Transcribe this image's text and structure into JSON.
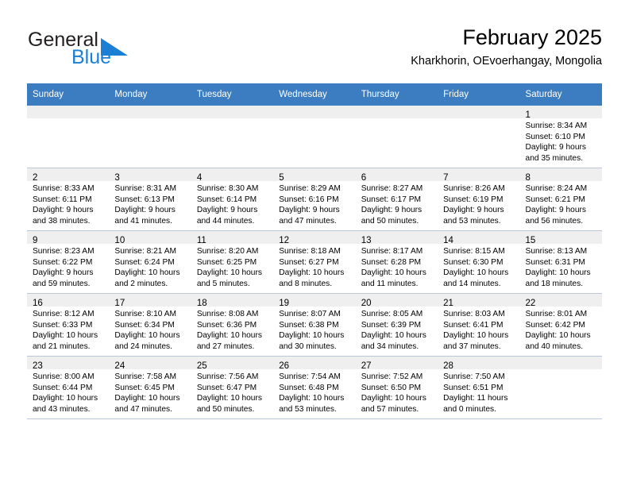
{
  "brand": {
    "name_part1": "General",
    "name_part2": "Blue",
    "triangle_color": "#1b7fd4",
    "text_color": "#231f20"
  },
  "header": {
    "title": "February 2025",
    "subtitle": "Kharkhorin, OEvoerhangay, Mongolia"
  },
  "theme": {
    "header_bg": "#3b7dc0",
    "header_text": "#ffffff",
    "daynum_band_bg": "#efefef",
    "row_border": "#b9c7d6"
  },
  "weekday_headers": [
    "Sunday",
    "Monday",
    "Tuesday",
    "Wednesday",
    "Thursday",
    "Friday",
    "Saturday"
  ],
  "weeks": [
    [
      {
        "empty": true
      },
      {
        "empty": true
      },
      {
        "empty": true
      },
      {
        "empty": true
      },
      {
        "empty": true
      },
      {
        "empty": true
      },
      {
        "day": "1",
        "sunrise": "Sunrise: 8:34 AM",
        "sunset": "Sunset: 6:10 PM",
        "daylight1": "Daylight: 9 hours",
        "daylight2": "and 35 minutes."
      }
    ],
    [
      {
        "day": "2",
        "sunrise": "Sunrise: 8:33 AM",
        "sunset": "Sunset: 6:11 PM",
        "daylight1": "Daylight: 9 hours",
        "daylight2": "and 38 minutes."
      },
      {
        "day": "3",
        "sunrise": "Sunrise: 8:31 AM",
        "sunset": "Sunset: 6:13 PM",
        "daylight1": "Daylight: 9 hours",
        "daylight2": "and 41 minutes."
      },
      {
        "day": "4",
        "sunrise": "Sunrise: 8:30 AM",
        "sunset": "Sunset: 6:14 PM",
        "daylight1": "Daylight: 9 hours",
        "daylight2": "and 44 minutes."
      },
      {
        "day": "5",
        "sunrise": "Sunrise: 8:29 AM",
        "sunset": "Sunset: 6:16 PM",
        "daylight1": "Daylight: 9 hours",
        "daylight2": "and 47 minutes."
      },
      {
        "day": "6",
        "sunrise": "Sunrise: 8:27 AM",
        "sunset": "Sunset: 6:17 PM",
        "daylight1": "Daylight: 9 hours",
        "daylight2": "and 50 minutes."
      },
      {
        "day": "7",
        "sunrise": "Sunrise: 8:26 AM",
        "sunset": "Sunset: 6:19 PM",
        "daylight1": "Daylight: 9 hours",
        "daylight2": "and 53 minutes."
      },
      {
        "day": "8",
        "sunrise": "Sunrise: 8:24 AM",
        "sunset": "Sunset: 6:21 PM",
        "daylight1": "Daylight: 9 hours",
        "daylight2": "and 56 minutes."
      }
    ],
    [
      {
        "day": "9",
        "sunrise": "Sunrise: 8:23 AM",
        "sunset": "Sunset: 6:22 PM",
        "daylight1": "Daylight: 9 hours",
        "daylight2": "and 59 minutes."
      },
      {
        "day": "10",
        "sunrise": "Sunrise: 8:21 AM",
        "sunset": "Sunset: 6:24 PM",
        "daylight1": "Daylight: 10 hours",
        "daylight2": "and 2 minutes."
      },
      {
        "day": "11",
        "sunrise": "Sunrise: 8:20 AM",
        "sunset": "Sunset: 6:25 PM",
        "daylight1": "Daylight: 10 hours",
        "daylight2": "and 5 minutes."
      },
      {
        "day": "12",
        "sunrise": "Sunrise: 8:18 AM",
        "sunset": "Sunset: 6:27 PM",
        "daylight1": "Daylight: 10 hours",
        "daylight2": "and 8 minutes."
      },
      {
        "day": "13",
        "sunrise": "Sunrise: 8:17 AM",
        "sunset": "Sunset: 6:28 PM",
        "daylight1": "Daylight: 10 hours",
        "daylight2": "and 11 minutes."
      },
      {
        "day": "14",
        "sunrise": "Sunrise: 8:15 AM",
        "sunset": "Sunset: 6:30 PM",
        "daylight1": "Daylight: 10 hours",
        "daylight2": "and 14 minutes."
      },
      {
        "day": "15",
        "sunrise": "Sunrise: 8:13 AM",
        "sunset": "Sunset: 6:31 PM",
        "daylight1": "Daylight: 10 hours",
        "daylight2": "and 18 minutes."
      }
    ],
    [
      {
        "day": "16",
        "sunrise": "Sunrise: 8:12 AM",
        "sunset": "Sunset: 6:33 PM",
        "daylight1": "Daylight: 10 hours",
        "daylight2": "and 21 minutes."
      },
      {
        "day": "17",
        "sunrise": "Sunrise: 8:10 AM",
        "sunset": "Sunset: 6:34 PM",
        "daylight1": "Daylight: 10 hours",
        "daylight2": "and 24 minutes."
      },
      {
        "day": "18",
        "sunrise": "Sunrise: 8:08 AM",
        "sunset": "Sunset: 6:36 PM",
        "daylight1": "Daylight: 10 hours",
        "daylight2": "and 27 minutes."
      },
      {
        "day": "19",
        "sunrise": "Sunrise: 8:07 AM",
        "sunset": "Sunset: 6:38 PM",
        "daylight1": "Daylight: 10 hours",
        "daylight2": "and 30 minutes."
      },
      {
        "day": "20",
        "sunrise": "Sunrise: 8:05 AM",
        "sunset": "Sunset: 6:39 PM",
        "daylight1": "Daylight: 10 hours",
        "daylight2": "and 34 minutes."
      },
      {
        "day": "21",
        "sunrise": "Sunrise: 8:03 AM",
        "sunset": "Sunset: 6:41 PM",
        "daylight1": "Daylight: 10 hours",
        "daylight2": "and 37 minutes."
      },
      {
        "day": "22",
        "sunrise": "Sunrise: 8:01 AM",
        "sunset": "Sunset: 6:42 PM",
        "daylight1": "Daylight: 10 hours",
        "daylight2": "and 40 minutes."
      }
    ],
    [
      {
        "day": "23",
        "sunrise": "Sunrise: 8:00 AM",
        "sunset": "Sunset: 6:44 PM",
        "daylight1": "Daylight: 10 hours",
        "daylight2": "and 43 minutes."
      },
      {
        "day": "24",
        "sunrise": "Sunrise: 7:58 AM",
        "sunset": "Sunset: 6:45 PM",
        "daylight1": "Daylight: 10 hours",
        "daylight2": "and 47 minutes."
      },
      {
        "day": "25",
        "sunrise": "Sunrise: 7:56 AM",
        "sunset": "Sunset: 6:47 PM",
        "daylight1": "Daylight: 10 hours",
        "daylight2": "and 50 minutes."
      },
      {
        "day": "26",
        "sunrise": "Sunrise: 7:54 AM",
        "sunset": "Sunset: 6:48 PM",
        "daylight1": "Daylight: 10 hours",
        "daylight2": "and 53 minutes."
      },
      {
        "day": "27",
        "sunrise": "Sunrise: 7:52 AM",
        "sunset": "Sunset: 6:50 PM",
        "daylight1": "Daylight: 10 hours",
        "daylight2": "and 57 minutes."
      },
      {
        "day": "28",
        "sunrise": "Sunrise: 7:50 AM",
        "sunset": "Sunset: 6:51 PM",
        "daylight1": "Daylight: 11 hours",
        "daylight2": "and 0 minutes."
      },
      {
        "empty": true
      }
    ]
  ]
}
